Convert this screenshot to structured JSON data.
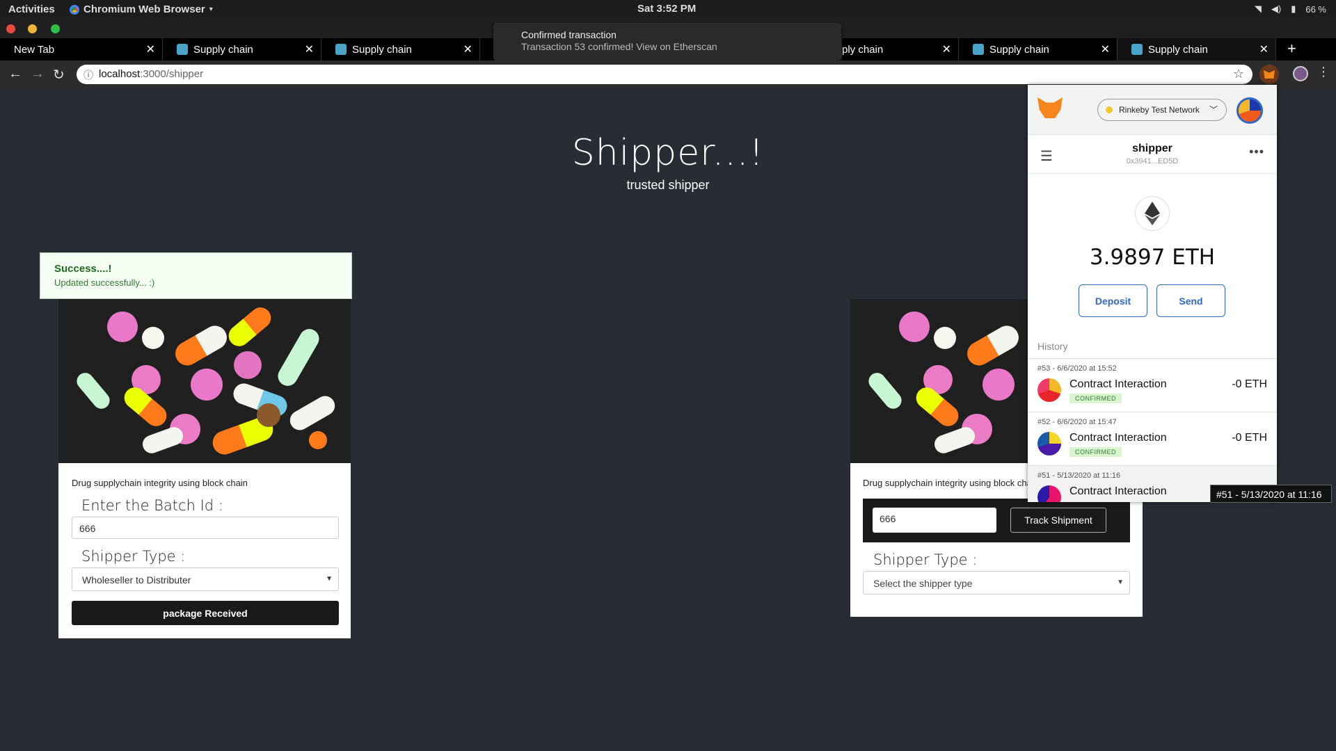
{
  "topbar": {
    "activities": "Activities",
    "app_name": "Chromium Web Browser",
    "clock": "Sat  3:52 PM",
    "battery": "66 %"
  },
  "tabs": [
    {
      "title": "New Tab"
    },
    {
      "title": "Supply chain"
    },
    {
      "title": "Supply chain"
    },
    {
      "title": ""
    },
    {
      "title": "ply chain"
    },
    {
      "title": "Supply chain"
    },
    {
      "title": "Supply chain"
    }
  ],
  "toast": {
    "title": "Confirmed transaction",
    "message": "Transaction 53 confirmed! View on Etherscan"
  },
  "address": {
    "host": "localhost",
    "path": ":3000/shipper"
  },
  "page": {
    "heading": "Shipper...!",
    "subheading": "trusted shipper"
  },
  "alert": {
    "title": "Success....!",
    "message": "Updated successfully... :)"
  },
  "card_left": {
    "caption": "Drug supplychain integrity using block chain",
    "batch_label": "Enter the Batch Id :",
    "batch_value": "666",
    "shipper_label": "Shipper Type :",
    "shipper_value": "Wholeseller to Distributer",
    "button": "package Received"
  },
  "card_right": {
    "caption": "Drug supplychain integrity using block chain",
    "track_value": "666",
    "track_button": "Track Shipment",
    "shipper_label": "Shipper Type :",
    "shipper_placeholder": "Select the shipper type"
  },
  "metamask": {
    "network": "Rinkeby Test Network",
    "network_dot_color": "#f0c92c",
    "account_name": "shipper",
    "account_address": "0x3941...ED5D",
    "balance": "3.9897 ETH",
    "deposit": "Deposit",
    "send": "Send",
    "history_label": "History",
    "history": [
      {
        "date": "#53 - 6/6/2020 at 15:52",
        "type": "Contract Interaction",
        "status": "CONFIRMED",
        "amount": "-0 ETH"
      },
      {
        "date": "#52 - 6/6/2020 at 15:47",
        "type": "Contract Interaction",
        "status": "CONFIRMED",
        "amount": "-0 ETH"
      },
      {
        "date": "#51 - 5/13/2020 at 11:16",
        "type": "Contract Interaction",
        "status": "",
        "amount": ""
      }
    ]
  },
  "tooltip": "#51 - 5/13/2020 at 11:16"
}
